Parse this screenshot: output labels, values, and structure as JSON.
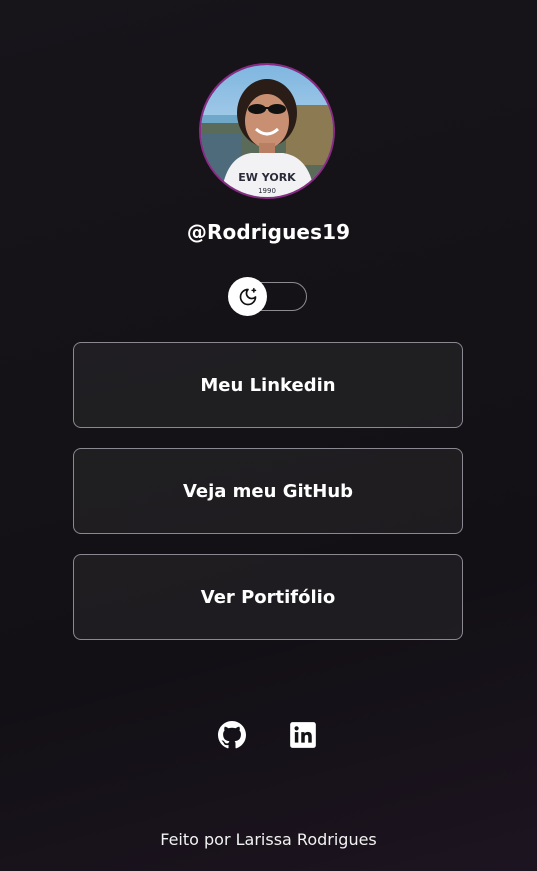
{
  "profile": {
    "username": "@Rodrigues19",
    "avatar_icon": "profile-photo",
    "avatar_border_color": "#8a2a86"
  },
  "theme_toggle": {
    "icon": "moon-stars-icon",
    "state": "dark"
  },
  "links": [
    {
      "label": "Meu Linkedin"
    },
    {
      "label": "Veja meu GitHub"
    },
    {
      "label": "Ver Portifólio"
    }
  ],
  "social": [
    {
      "icon": "github-icon"
    },
    {
      "icon": "linkedin-icon"
    }
  ],
  "footer": {
    "text": "Feito por Larissa Rodrigues"
  }
}
